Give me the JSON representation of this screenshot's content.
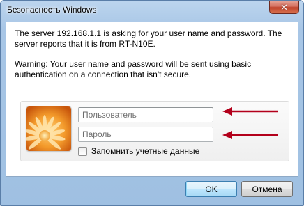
{
  "window": {
    "title": "Безопасность Windows",
    "close_label": "✕"
  },
  "message": {
    "line1": "The server 192.168.1.1 is asking for your user name and password. The server reports that it is from RT-N10E.",
    "line2": "Warning: Your user name and password will be sent using basic authentication on a connection that isn't secure."
  },
  "credentials": {
    "username_placeholder": "Пользователь",
    "password_placeholder": "Пароль",
    "remember_label": "Запомнить учетные данные",
    "remember_checked": false,
    "tile_icon": "flower-user-icon"
  },
  "buttons": {
    "ok_label": "OK",
    "cancel_label": "Отмена"
  },
  "colors": {
    "arrow": "#b3001b",
    "frame": "#a8c6e6"
  }
}
